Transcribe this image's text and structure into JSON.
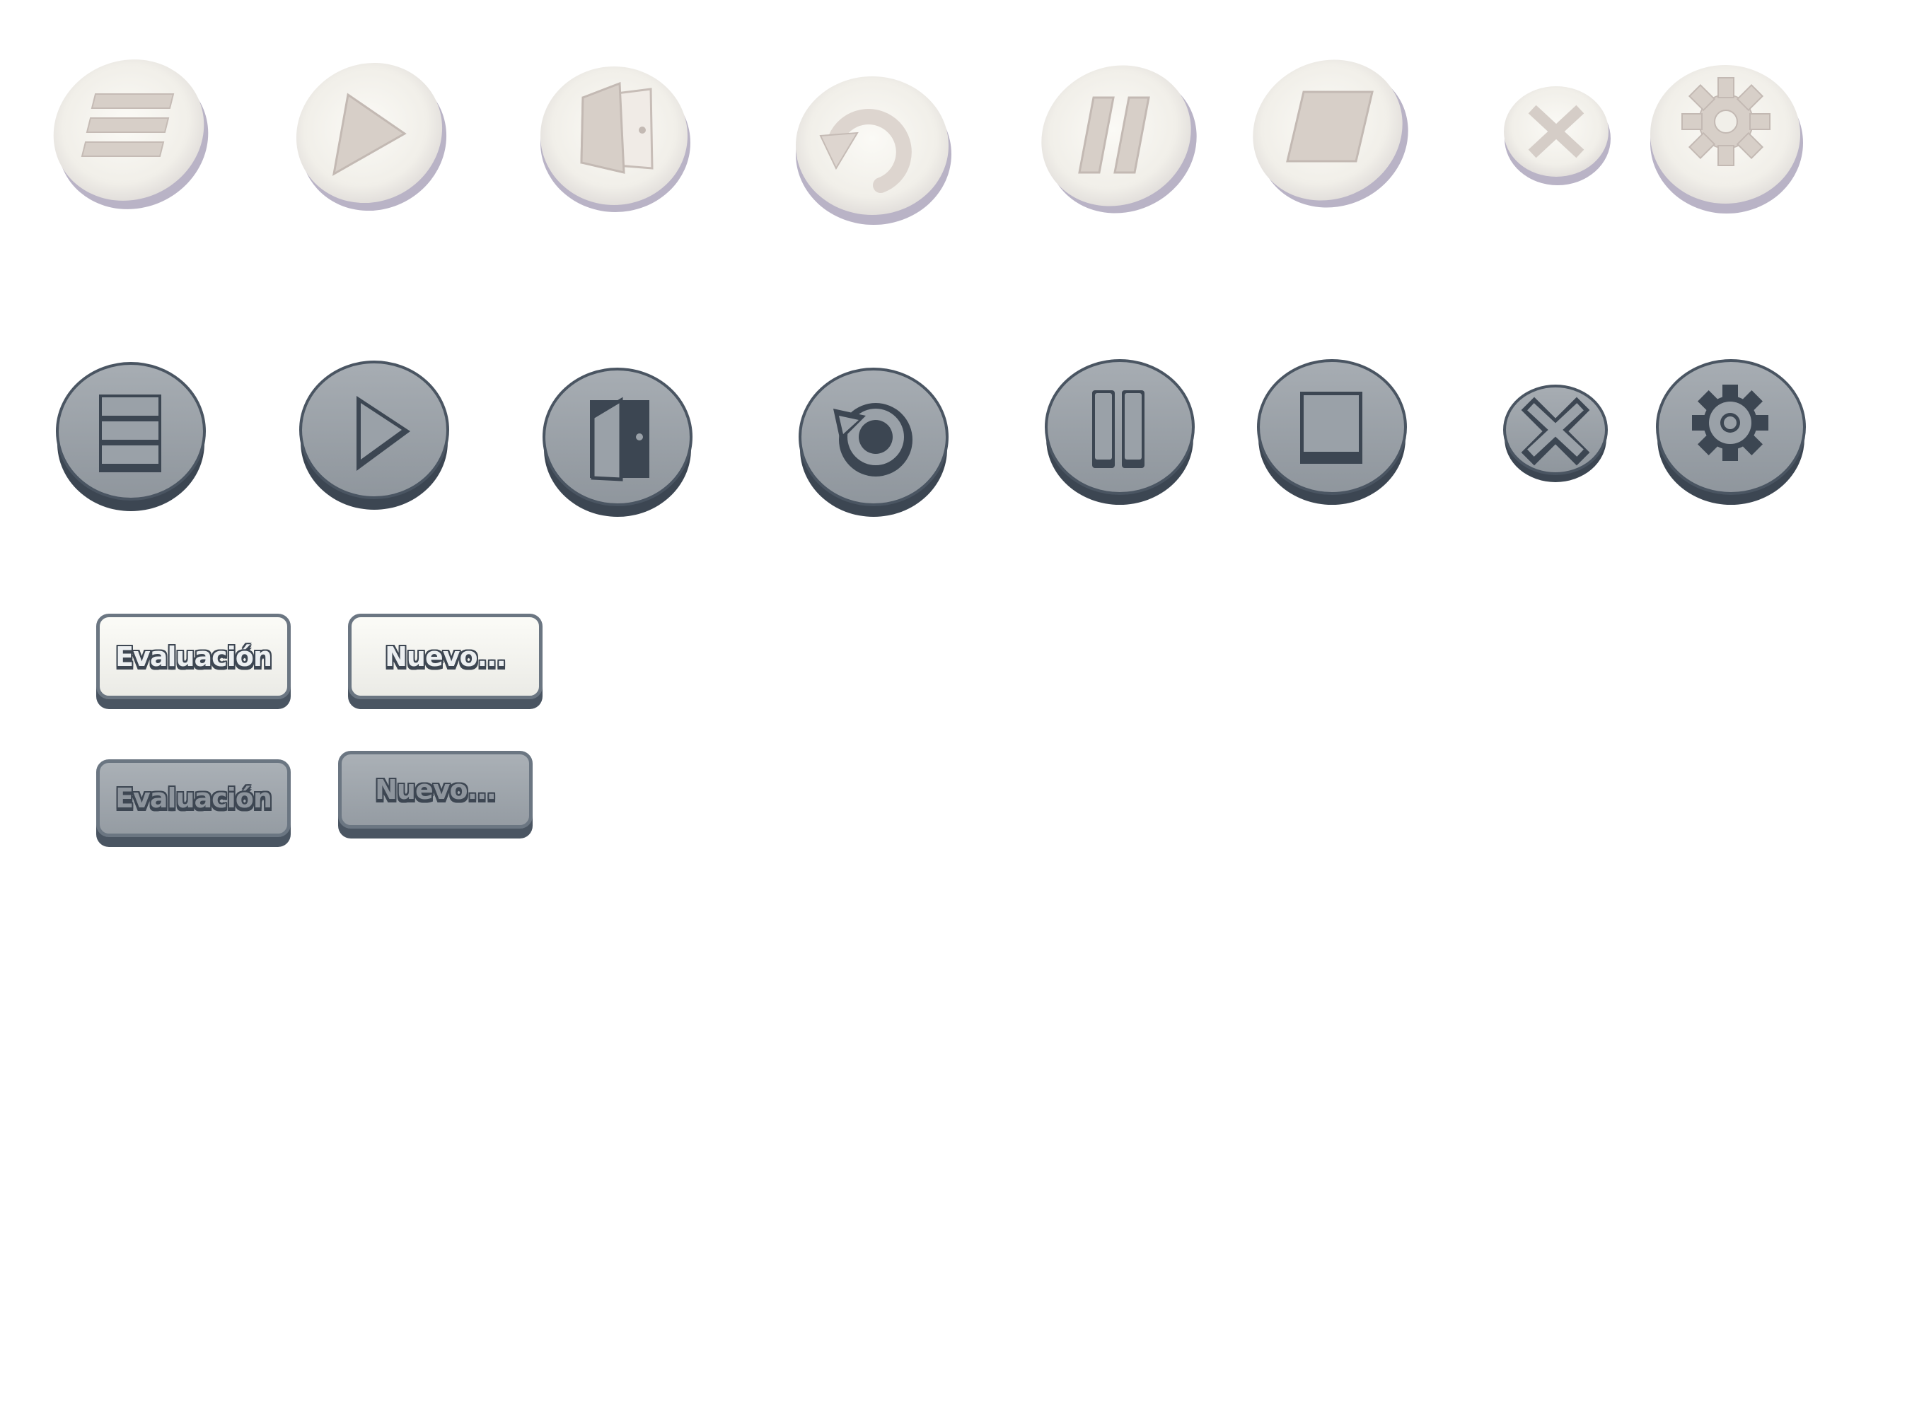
{
  "colors": {
    "light_face": "#f3f1ec",
    "light_shadow": "#b7b1c4",
    "light_icon": "#d6cec8",
    "dark_face": "#9aa1a8",
    "dark_base": "#3c4652",
    "dark_icon": "#3c4652",
    "outline": "#4a5562"
  },
  "icon_rows": [
    {
      "style": "light",
      "icons": [
        "menu-icon",
        "play-icon",
        "door-exit-icon",
        "restart-icon",
        "pause-icon",
        "stop-icon",
        "close-icon",
        "gear-icon"
      ]
    },
    {
      "style": "dark",
      "icons": [
        "menu-icon",
        "play-icon",
        "door-exit-icon",
        "restart-icon",
        "pause-icon",
        "stop-icon",
        "close-icon",
        "gear-icon"
      ]
    }
  ],
  "text_buttons": {
    "light_evaluation": "Evaluación",
    "light_new": "Nuevo...",
    "dark_evaluation": "Evaluación",
    "dark_new": "Nuevo..."
  }
}
